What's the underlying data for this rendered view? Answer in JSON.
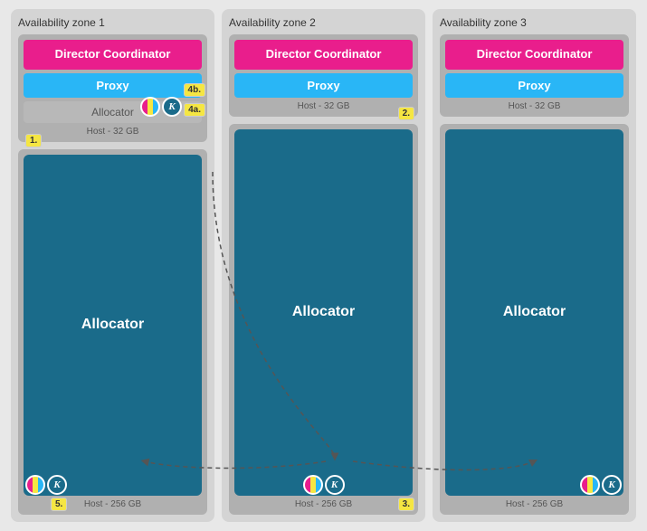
{
  "zones": [
    {
      "id": "zone1",
      "title": "Availability zone 1",
      "top_host_label": "Host - 32 GB",
      "bottom_host_label": "Host - 256 GB",
      "director_label": "Director Coordinator",
      "proxy_label": "Proxy",
      "allocator_small_label": "Allocator",
      "allocator_big_label": "Allocator",
      "badges": [
        {
          "label": "1.",
          "position": "bottom-left-top"
        },
        {
          "label": "4b.",
          "position": "top-right"
        },
        {
          "label": "4a.",
          "position": "top-right-lower"
        },
        {
          "label": "5.",
          "position": "bottom-left"
        }
      ]
    },
    {
      "id": "zone2",
      "title": "Availability zone 2",
      "top_host_label": "Host - 32 GB",
      "bottom_host_label": "Host - 256 GB",
      "director_label": "Director Coordinator",
      "proxy_label": "Proxy",
      "allocator_small_label": "",
      "allocator_big_label": "Allocator",
      "badges": [
        {
          "label": "2.",
          "position": "top-right"
        },
        {
          "label": "3.",
          "position": "bottom-left"
        }
      ]
    },
    {
      "id": "zone3",
      "title": "Availability zone 3",
      "top_host_label": "Host - 32 GB",
      "bottom_host_label": "Host - 256 GB",
      "director_label": "Director Coordinator",
      "proxy_label": "Proxy",
      "allocator_small_label": "",
      "allocator_big_label": "Allocator",
      "badges": []
    }
  ],
  "colors": {
    "director_bg": "#e91e8c",
    "proxy_bg": "#29b6f6",
    "allocator_big_bg": "#1a6b8a",
    "zone_bg": "#d0d0d0",
    "host_bg": "#b8b8b8",
    "badge_bg": "#f5e642"
  }
}
